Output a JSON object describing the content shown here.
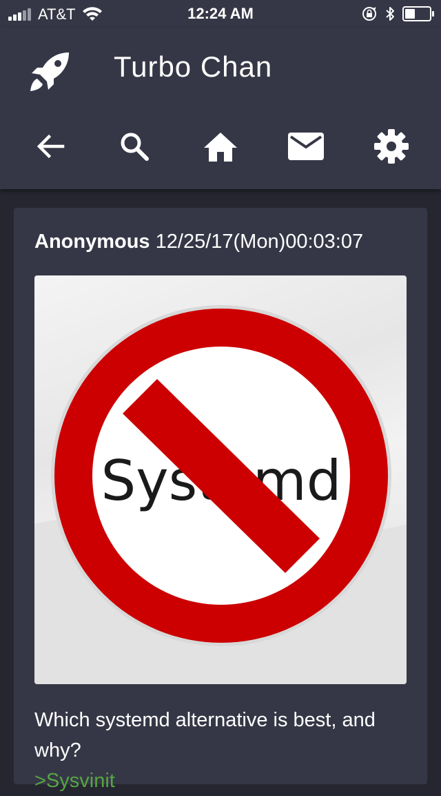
{
  "status_bar": {
    "carrier": "AT&T",
    "time": "12:24 AM"
  },
  "app": {
    "title": "Turbo Chan"
  },
  "nav": {
    "icons": [
      "back-arrow-icon",
      "search-icon",
      "home-icon",
      "mail-icon",
      "settings-gear-icon"
    ]
  },
  "post": {
    "author": "Anonymous",
    "datetime": "12/25/17(Mon)00:03:07",
    "image": {
      "sign_text": "Systemd",
      "sign_color": "#cc0000"
    },
    "body": "Which systemd alternative is best, and why?",
    "greentext": ">Sysvinit"
  },
  "colors": {
    "appbar": "#363746",
    "background": "#262631",
    "card": "#363746",
    "greentext": "#55a643"
  }
}
